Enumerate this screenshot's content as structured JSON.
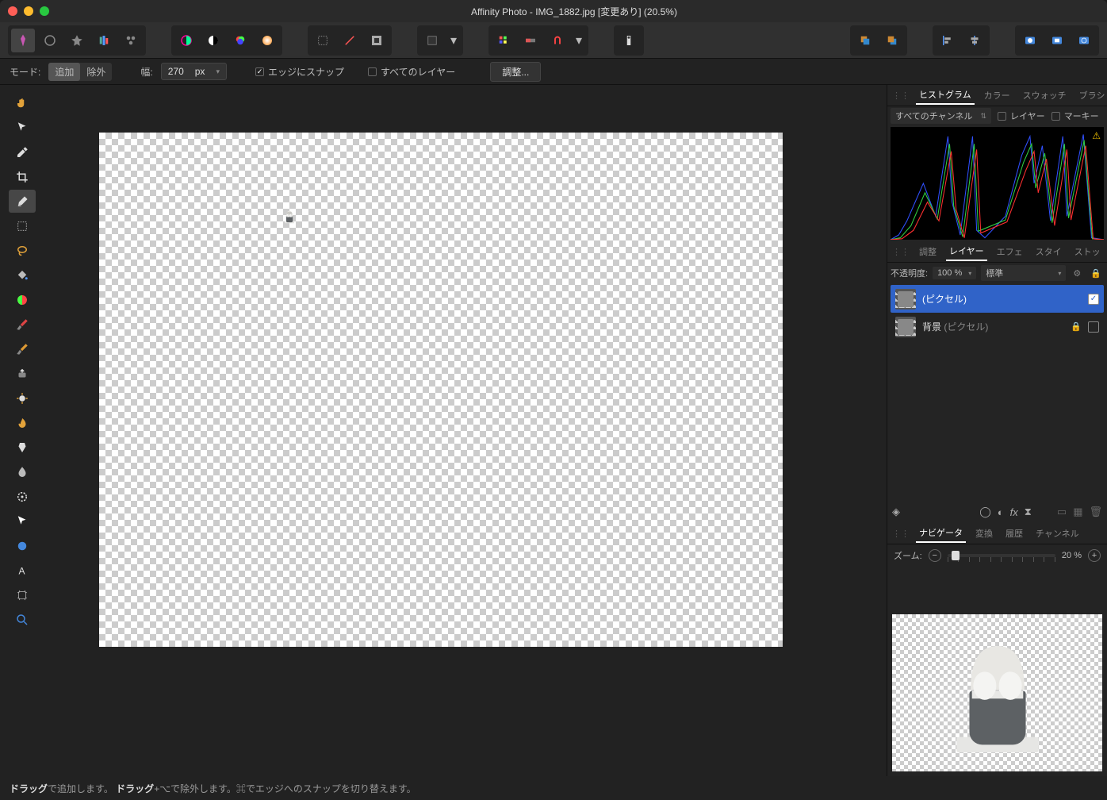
{
  "titlebar": {
    "title": "Affinity Photo - IMG_1882.jpg [変更あり] (20.5%)"
  },
  "toolbar_groups": {
    "group4_dropdown": "▾"
  },
  "options": {
    "mode_label": "モード:",
    "mode_add": "追加",
    "mode_sub": "除外",
    "width_label": "幅:",
    "width_value": "270",
    "width_unit": "px",
    "snap": "エッジにスナップ",
    "all_layers": "すべてのレイヤー",
    "adjust_btn": "調整..."
  },
  "panels": {
    "hist_tabs": [
      "ヒストグラム",
      "カラー",
      "スウォッチ",
      "ブラシ"
    ],
    "hist_chan": "すべてのチャンネル",
    "hist_layer": "レイヤー",
    "hist_marquee": "マーキー",
    "mid_tabs": [
      "調整",
      "レイヤー",
      "エフェ",
      "スタイ",
      "ストッ"
    ],
    "opacity_label": "不透明度:",
    "opacity_value": "100 %",
    "blend_mode": "標準",
    "layers": [
      {
        "name": "(ピクセル)",
        "selected": true,
        "visible": true,
        "locked": false
      },
      {
        "name": "背景 (ピクセル)",
        "prefix": "背景",
        "suffix": "(ピクセル)",
        "selected": false,
        "visible": true,
        "locked": true
      }
    ],
    "nav_tabs": [
      "ナビゲータ",
      "変換",
      "履歴",
      "チャンネル"
    ],
    "zoom_label": "ズーム:",
    "zoom_value": "20 %"
  },
  "status": {
    "drag1": "ドラッグ",
    "t1": "で追加します。",
    "drag2": "ドラッグ",
    "t2": "+⌥で除外します。⌘でエッジへのスナップを切り替えます。"
  },
  "tools": [
    "hand",
    "pointer",
    "flood",
    "crop",
    "brush-select",
    "current",
    "lasso",
    "bucket",
    "gradient",
    "eraser",
    "paint",
    "clone",
    "sponge",
    "smudge",
    "inpaint",
    "blur",
    "mix",
    "pen",
    "shape",
    "text",
    "mesh",
    "zoom"
  ]
}
